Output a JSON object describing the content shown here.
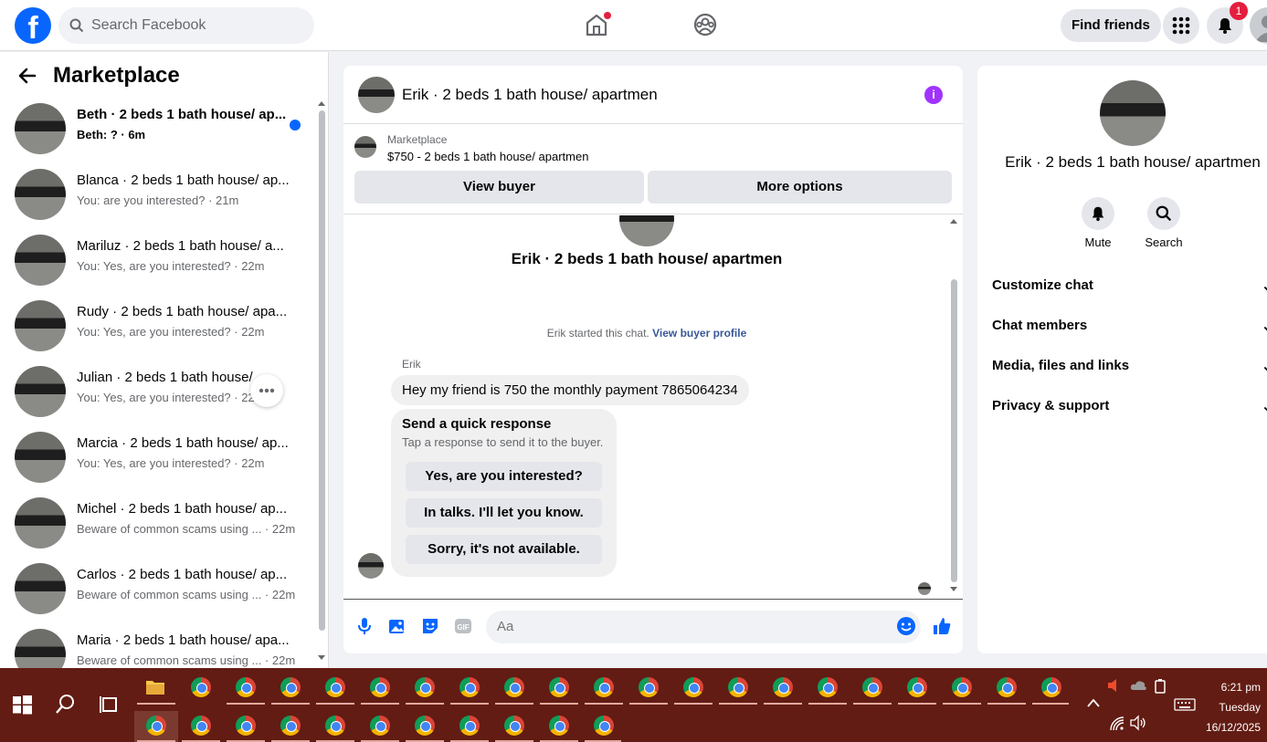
{
  "topbar": {
    "search_placeholder": "Search Facebook",
    "find_friends": "Find friends",
    "notification_count": "1"
  },
  "sidebar": {
    "title": "Marketplace",
    "conversations": [
      {
        "name": "Beth · 2 beds 1 bath house/ ap...",
        "preview": "Beth: ? · 6m",
        "unread": true
      },
      {
        "name": "Blanca · 2 beds 1 bath house/ ap...",
        "preview": "You: are you interested? · 21m",
        "unread": false
      },
      {
        "name": "Mariluz · 2 beds 1 bath house/ a...",
        "preview": "You: Yes, are you interested? · 22m",
        "unread": false
      },
      {
        "name": "Rudy · 2 beds 1 bath house/ apa...",
        "preview": "You: Yes, are you interested? · 22m",
        "unread": false
      },
      {
        "name": "Julian · 2 beds 1 bath house/ ...",
        "preview": "You: Yes, are you interested? · 22m",
        "unread": false
      },
      {
        "name": "Marcia · 2 beds 1 bath house/ ap...",
        "preview": "You: Yes, are you interested? · 22m",
        "unread": false
      },
      {
        "name": "Michel · 2 beds 1 bath house/ ap...",
        "preview": "Beware of common scams using ... · 22m",
        "unread": false
      },
      {
        "name": "Carlos · 2 beds 1 bath house/ ap...",
        "preview": "Beware of common scams using ... · 22m",
        "unread": false
      },
      {
        "name": "Maria · 2 beds 1 bath house/ apa...",
        "preview": "Beware of common scams using ... · 22m",
        "unread": false
      }
    ]
  },
  "chat": {
    "title": "Erik · 2 beds 1 bath house/ apartmen",
    "listing_label": "Marketplace",
    "listing_price": "$750 - 2 beds 1 bath house/ apartmen",
    "view_buyer": "View buyer",
    "more_options": "More options",
    "started_text": "Erik started this chat.",
    "view_buyer_profile": "View buyer profile",
    "sender": "Erik",
    "message": "Hey my friend is 750 the monthly payment 7865064234",
    "quick_title": "Send a quick response",
    "quick_subtitle": "Tap a response to send it to the buyer.",
    "quick_replies": [
      "Yes, are you interested?",
      "In talks. I'll let you know.",
      "Sorry, it's not available."
    ],
    "input_placeholder": "Aa"
  },
  "details": {
    "name": "Erik · 2 beds 1 bath house/ apartmen",
    "mute": "Mute",
    "search": "Search",
    "sections": [
      "Customize chat",
      "Chat members",
      "Media, files and links",
      "Privacy & support"
    ]
  },
  "taskbar": {
    "time": "6:21 pm",
    "day": "Tuesday",
    "date": "16/12/2025"
  },
  "colors": {
    "brand": "#0866ff",
    "messenger_accent": "#a033ff",
    "taskbar": "#621c13"
  }
}
